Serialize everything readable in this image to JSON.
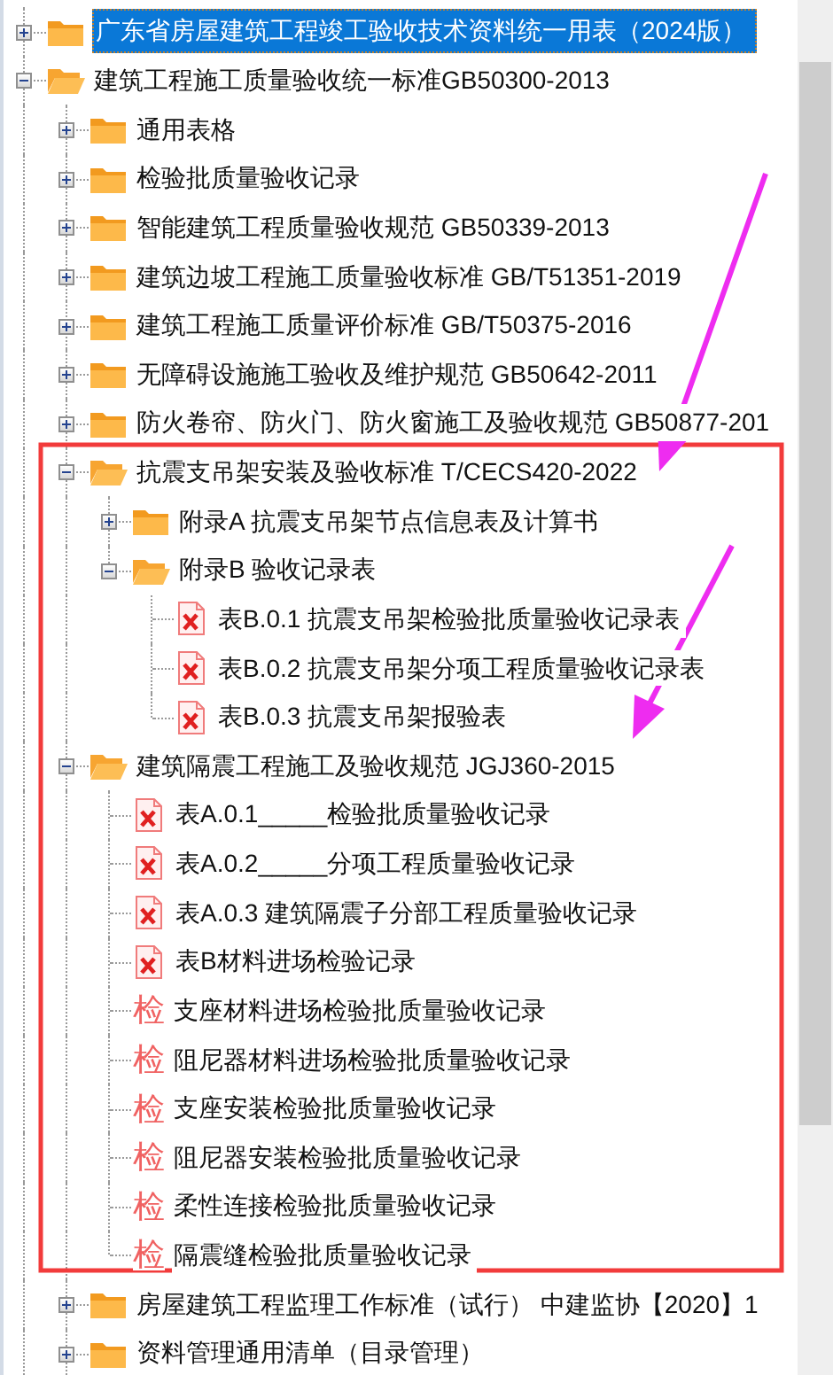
{
  "tree": {
    "items": [
      {
        "kind": "folder",
        "label": "广东省房屋建筑工程竣工验收技术资料统一用表（2024版）",
        "expanded": false,
        "selected": true
      },
      {
        "kind": "folder",
        "label": "建筑工程施工质量验收统一标准GB50300-2013",
        "expanded": true,
        "selected": false,
        "children": [
          {
            "kind": "folder",
            "label": "通用表格",
            "expanded": false,
            "selected": false
          },
          {
            "kind": "folder",
            "label": "检验批质量验收记录",
            "expanded": false,
            "selected": false
          },
          {
            "kind": "folder",
            "label": "智能建筑工程质量验收规范 GB50339-2013",
            "expanded": false,
            "selected": false
          },
          {
            "kind": "folder",
            "label": "建筑边坡工程施工质量验收标准 GB/T51351-2019",
            "expanded": false,
            "selected": false
          },
          {
            "kind": "folder",
            "label": "建筑工程施工质量评价标准 GB/T50375-2016",
            "expanded": false,
            "selected": false
          },
          {
            "kind": "folder",
            "label": "无障碍设施施工验收及维护规范 GB50642-2011",
            "expanded": false,
            "selected": false
          },
          {
            "kind": "folder",
            "label": "防火卷帘、防火门、防火窗施工及验收规范 GB50877-201",
            "expanded": false,
            "selected": false
          },
          {
            "kind": "folder",
            "label": "抗震支吊架安装及验收标准 T/CECS420-2022",
            "expanded": true,
            "selected": false,
            "children": [
              {
                "kind": "folder",
                "label": "附录A 抗震支吊架节点信息表及计算书",
                "expanded": false,
                "selected": false
              },
              {
                "kind": "folder",
                "label": "附录B 验收记录表",
                "expanded": true,
                "selected": false,
                "children": [
                  {
                    "kind": "doc",
                    "label": "表B.0.1 抗震支吊架检验批质量验收记录表",
                    "selected": false
                  },
                  {
                    "kind": "doc",
                    "label": "表B.0.2 抗震支吊架分项工程质量验收记录表",
                    "selected": false
                  },
                  {
                    "kind": "doc",
                    "label": "表B.0.3 抗震支吊架报验表",
                    "selected": false
                  }
                ]
              }
            ]
          },
          {
            "kind": "folder",
            "label": "建筑隔震工程施工及验收规范 JGJ360-2015",
            "expanded": true,
            "selected": false,
            "children": [
              {
                "kind": "doc",
                "label": "表A.0.1_____检验批质量验收记录",
                "selected": false
              },
              {
                "kind": "doc",
                "label": "表A.0.2_____分项工程质量验收记录",
                "selected": false
              },
              {
                "kind": "doc",
                "label": "表A.0.3 建筑隔震子分部工程质量验收记录",
                "selected": false
              },
              {
                "kind": "doc",
                "label": "表B材料进场检验记录",
                "selected": false
              },
              {
                "kind": "form",
                "icon": "检",
                "label": "支座材料进场检验批质量验收记录",
                "selected": false
              },
              {
                "kind": "form",
                "icon": "检",
                "label": "阻尼器材料进场检验批质量验收记录",
                "selected": false
              },
              {
                "kind": "form",
                "icon": "检",
                "label": "支座安装检验批质量验收记录",
                "selected": false
              },
              {
                "kind": "form",
                "icon": "检",
                "label": "阻尼器安装检验批质量验收记录",
                "selected": false
              },
              {
                "kind": "form",
                "icon": "检",
                "label": "柔性连接检验批质量验收记录",
                "selected": false
              },
              {
                "kind": "form",
                "icon": "检",
                "label": "隔震缝检验批质量验收记录",
                "selected": false
              }
            ]
          },
          {
            "kind": "folder",
            "label": "房屋建筑工程监理工作标准（试行） 中建监协【2020】1",
            "expanded": false,
            "selected": false
          },
          {
            "kind": "folder",
            "label": "资料管理通用清单（目录管理）",
            "expanded": false,
            "selected": false
          }
        ]
      }
    ]
  }
}
